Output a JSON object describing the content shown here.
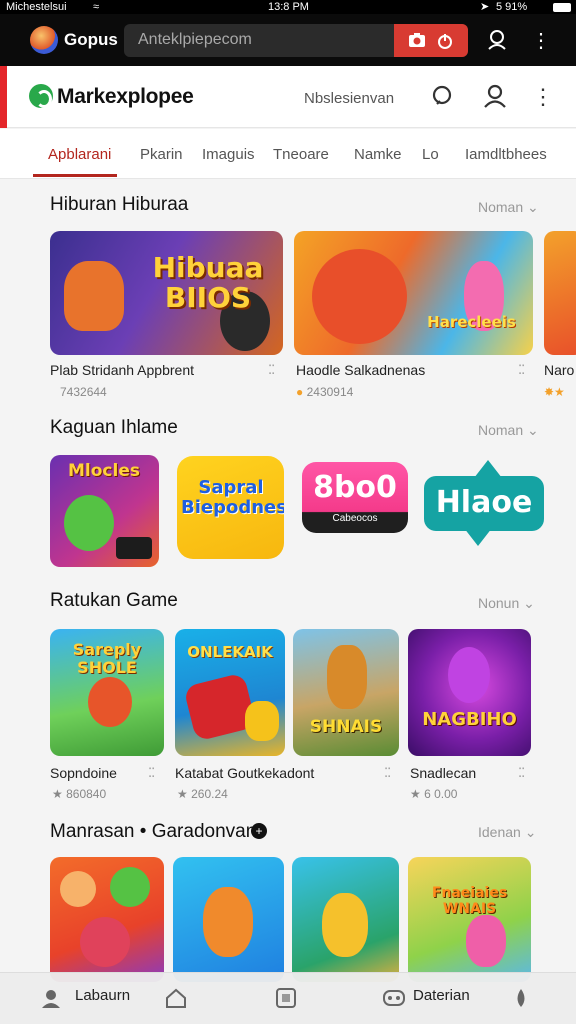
{
  "status_bar": {
    "carrier": "Michestelsui",
    "time": "13:8 PM",
    "battery": "5 91%"
  },
  "browser": {
    "tab_title": "Gopus",
    "url": "Anteklpiepecom",
    "icons": [
      "camera-icon",
      "power-icon",
      "profile-icon",
      "more-vert-icon"
    ]
  },
  "app_header": {
    "brand": "Markexplopee",
    "link": "Nbslesienvan",
    "icons": [
      "search-icon",
      "user-icon",
      "more-vert-icon"
    ],
    "accent_color": "#e4262a"
  },
  "tabs": [
    {
      "label": "Apblarani",
      "active": true
    },
    {
      "label": "Pkarin",
      "active": false
    },
    {
      "label": "Imaguis",
      "active": false
    },
    {
      "label": "Tneoare",
      "active": false
    },
    {
      "label": "Namke",
      "active": false
    },
    {
      "label": "Lo",
      "active": false
    },
    {
      "label": "Iamdltbhees",
      "active": false
    }
  ],
  "sections": [
    {
      "title": "Hiburan Hiburaa",
      "more": "Noman",
      "cards": [
        {
          "art_text": "Hibuaa BIIOS",
          "name": "Plab Stridanh Appbrent",
          "meta": "7432644"
        },
        {
          "art_text": "Harecleeis",
          "name": "Haodle Salkadnenas",
          "meta": "2430914"
        },
        {
          "art_text": "",
          "name": "Naro",
          "meta": ""
        }
      ]
    },
    {
      "title": "Kaguan Ihlame",
      "more": "Noman",
      "cards": [
        {
          "art_text": "Mlocles"
        },
        {
          "art_text": "Sapral Biepodnes"
        },
        {
          "art_text": "8bo0",
          "sub_text": "Cabeocos"
        },
        {
          "art_text": "Hlaoe"
        }
      ]
    },
    {
      "title": "Ratukan Game",
      "more": "Nonun",
      "cards": [
        {
          "art_text": "Sareply SHOLE",
          "name": "Sopndoine",
          "meta": "★ 860840"
        },
        {
          "art_text": "ONLEKAIK",
          "name": "Katabat Goutkekadont",
          "meta": "★ 260.24"
        },
        {
          "art_text": "SHNAIS",
          "name": "",
          "meta": ""
        },
        {
          "art_text": "NAGBIHO",
          "name": "Snadlecan",
          "meta": "★ 6 0.00"
        }
      ]
    },
    {
      "title": "Manrasan • Garadonvan",
      "more": "Idenan",
      "cards": [
        {
          "art_text": ""
        },
        {
          "art_text": ""
        },
        {
          "art_text": ""
        },
        {
          "art_text": "Fnaeiaies WNAIS"
        }
      ]
    }
  ],
  "bottom_nav": [
    {
      "label": "Labaurn",
      "icon": "profile-icon"
    },
    {
      "label": "",
      "icon": "home-icon"
    },
    {
      "label": "",
      "icon": "square-icon"
    },
    {
      "label": "Daterian",
      "icon": "robot-icon"
    },
    {
      "label": "",
      "icon": "drop-icon"
    }
  ]
}
